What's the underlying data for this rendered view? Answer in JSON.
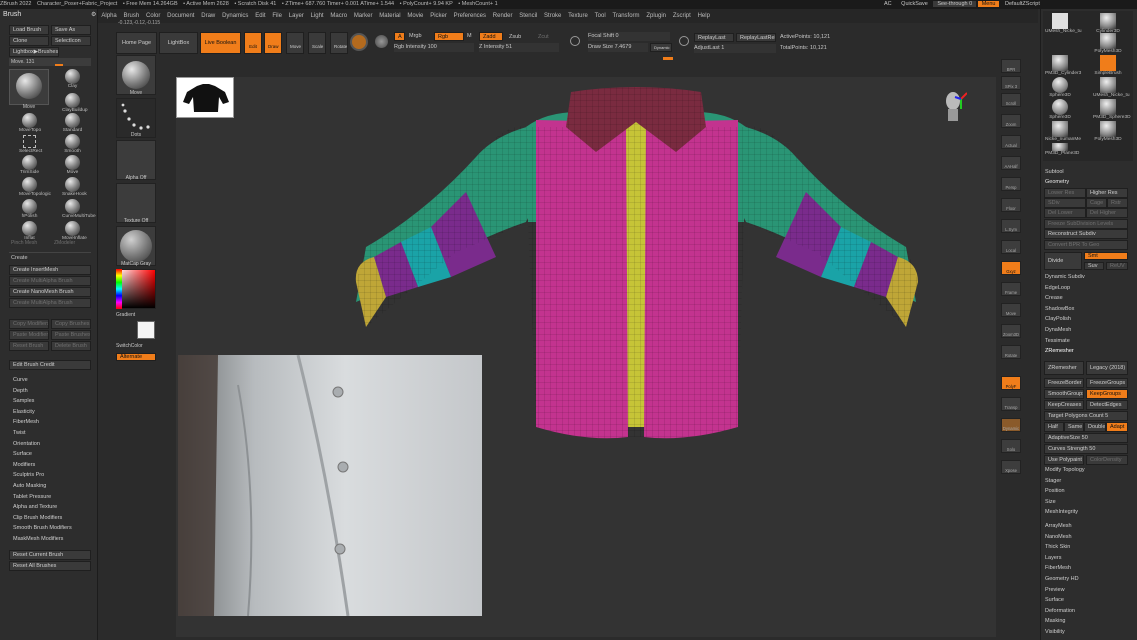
{
  "titlebar": {
    "items": [
      "ZBrush 2022",
      "Character_Poser+Fabric_Project",
      "• Free Mem 14.264GB",
      "• Active Mem 2628",
      "• Scratch Disk 41",
      "• ZTime+ 687.760 Timer+ 0.001 ATime+ 1.544",
      "• PolyCount+ 9.94 KP",
      "• MeshCount+ 1"
    ],
    "right": [
      "AC",
      "QuickSave",
      "See-through 0",
      "Menu",
      "DefaultZScript"
    ]
  },
  "menubar": {
    "items": [
      "Alpha",
      "Brush",
      "Color",
      "Document",
      "Draw",
      "Dynamics",
      "Edit",
      "File",
      "Layer",
      "Light",
      "Macro",
      "Marker",
      "Material",
      "Movie",
      "Picker",
      "Preferences",
      "Render",
      "Stencil",
      "Stroke",
      "Texture",
      "Tool",
      "Transform",
      "Zplugin",
      "Zscript",
      "Help"
    ]
  },
  "leftpanel": {
    "header": "Brush",
    "buttons": [
      "Load Brush",
      "Save As",
      "Clone",
      "SelectIcon",
      "Lightbox▶Brushes"
    ],
    "move_value": "Move. 131",
    "brushes": [
      "Move",
      "Clay",
      "ClayBuildup",
      "MoveTopo",
      "Standard",
      "SelectRect",
      "Smooth",
      "TrimSide",
      "Move",
      "MoveTopologic",
      "SnakeHook",
      "hPolish",
      "CurveMultiTube",
      "Inflat",
      "MoveInflate",
      "Pinch Mesh",
      "ZModeler"
    ],
    "create_header": "Create",
    "create_items": [
      "Create InsertMesh",
      "Create MultiAlpha Brush",
      "Create NanoMesh Brush",
      "Create MultiAlpha Brush",
      "Copy Modifiers",
      "Copy Brushes",
      "Paste Modifiers",
      "Paste Brushes",
      "Reset Brush",
      "Delete Brush"
    ],
    "edit_credit": "Edit Brush Credit",
    "sections": [
      "Curve",
      "Depth",
      "Samples",
      "Elasticity",
      "FiberMesh",
      "Twist",
      "Orientation",
      "Surface",
      "Modifiers",
      "Sculptris Pro",
      "Auto Masking",
      "Tablet Pressure",
      "Alpha and Texture",
      "Clip Brush Modifiers",
      "Smooth Brush Modifiers",
      "MaskMesh Modifiers"
    ],
    "reset_current": "Reset Current Brush",
    "reset_all": "Reset All Brushes"
  },
  "lefttools": {
    "labels": [
      "Move",
      "Dots",
      "Alpha Off",
      "Texture Off",
      "MatCap Gray",
      "Gradient",
      "SwitchColor",
      "Alternate"
    ]
  },
  "toolbar": {
    "home": "Home Page",
    "lightbox": "LightBox",
    "live_boolean": "Live Boolean",
    "edit": "Edit",
    "draw": "Draw",
    "move": "Move",
    "scale": "Scale",
    "rotate": "Rotate",
    "a": "A",
    "mrgb": "Mrgb",
    "rgb": "Rgb",
    "m": "M",
    "zadd": "Zadd",
    "zsub": "Zsub",
    "zcut": "Zcut",
    "rgb_intensity": "Rgb Intensity 100",
    "z_intensity": "Z Intensity 51",
    "focal_shift": "Focal Shift 0",
    "draw_size": "Draw Size 7.4679",
    "dynamic": "Dynamic",
    "replay_last": "ReplayLast",
    "replay_last_rel": "ReplayLastRel",
    "adjust_last": "AdjustLast 1",
    "active_points": "ActivePoints: 10,121",
    "total_points": "TotalPoints: 10,121",
    "coords": "-0.123,-0.12,-0.115"
  },
  "rightstrip": {
    "labels": [
      "BPR",
      "SPix 3",
      "Scroll",
      "Zoom",
      "Actual",
      "AAHalf",
      "Persp",
      "Floor",
      "L.Sym",
      "Local",
      "Gxyz",
      "Frame",
      "Move",
      "Zoom3D",
      "Rotate",
      "PolyF",
      "Transp",
      "Dynamic",
      "Solo",
      "Xpose"
    ]
  },
  "rightpanel": {
    "subtools": [
      "UMesh_Nicke_tu",
      "PolyMesh3D",
      "Cylinder3D",
      "PM3D_Cylinder3",
      "SimpleBrush",
      "Sphere3D",
      "UMesh_Nicke_tu",
      "Sphere3D",
      "PM3D_Sphere3D",
      "Nicke_numanMe",
      "PolyMesh3D",
      "PM3D_Plane3D"
    ],
    "subtool_header": "Subtool",
    "geometry_header": "Geometry",
    "higher_res": "Higher Res",
    "lower_res": "Lower Res",
    "sdiv": "SDiv",
    "cage": "Cage",
    "rstr": "Rstr",
    "del_lower": "Del Lower",
    "del_higher": "Del Higher",
    "freeze": "Freeze SubDivision Levels",
    "reconstruct": "Reconstruct Subdiv",
    "convert_bpr": "Convert BPR To Geo",
    "divide": "Divide",
    "smt": "Smt",
    "suv": "Suv",
    "reuv": "ReUV",
    "items": [
      "Dynamic Subdiv",
      "EdgeLoop",
      "Crease",
      "ShadowBox",
      "ClayPolish",
      "DynaMesh",
      "Tessimate",
      "ZRemesher"
    ],
    "zremesher_btn": "ZRemesher",
    "legacy": "Legacy (2018)",
    "freeze_border": "FreezeBorder",
    "freeze_groups": "FreezeGroups",
    "smooth_groups": "SmoothGroups",
    "keep_groups": "KeepGroups",
    "keep_creases": "KeepCreases",
    "detect_edges": "DetectEdges",
    "target_poly": "Target Polygons Count 5",
    "half": "Half",
    "same": "Same",
    "double": "Double",
    "adapt": "Adapt",
    "adaptive_size": "AdaptiveSize 50",
    "curves_strength": "Curves Strength 50",
    "use_polypaint": "Use Polypaint",
    "color_density": "ColorDensity",
    "lower_items": [
      "Modify Topology",
      "Stager",
      "Position",
      "Size",
      "MeshIntegrity"
    ],
    "extra_items": [
      "ArrayMesh",
      "NanoMesh",
      "Thick Skin",
      "Layers",
      "FiberMesh",
      "Geometry HD",
      "Preview",
      "Surface",
      "Deformation",
      "Masking",
      "Visibility"
    ]
  }
}
